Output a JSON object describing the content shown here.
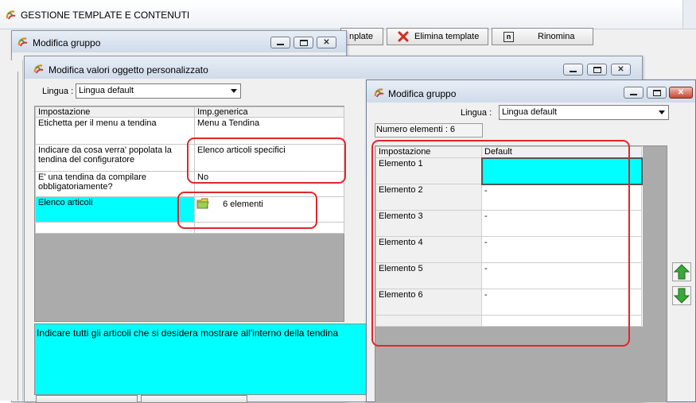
{
  "main_window": {
    "title": "GESTIONE TEMPLATE E CONTENUTI",
    "toolbar": {
      "template_label": "nplate",
      "delete_label": "Elimina template",
      "rename_label": "Rinomina"
    }
  },
  "group_dialog_back": {
    "title": "Modifica gruppo"
  },
  "edit_dialog": {
    "title": "Modifica valori oggetto personalizzato",
    "language_label": "Lingua :",
    "language_value": "Lingua default",
    "columns": [
      "Impostazione",
      "Imp.generica"
    ],
    "rows": [
      {
        "setting": "Etichetta per il menu a tendina",
        "value": "Menu a Tendina"
      },
      {
        "setting": "Indicare da cosa verra' popolata la tendina del configuratore",
        "value": "Elenco articoli specifici"
      },
      {
        "setting": "E' una tendina da compilare obbligatoriamente?",
        "value": "No"
      },
      {
        "setting": "Elenco articoli",
        "value": "6 elementi"
      }
    ],
    "description": "Indicare tutti gli articoli che si desidera mostrare all'interno della tendina"
  },
  "group_dialog_front": {
    "title": "Modifica gruppo",
    "language_label": "Lingua :",
    "language_value": "Lingua default",
    "count_label": "Numero elementi : 6",
    "columns": [
      "Impostazione",
      "Default"
    ],
    "rows": [
      {
        "name": "Elemento 1",
        "value": ""
      },
      {
        "name": "Elemento 2",
        "value": "-"
      },
      {
        "name": "Elemento 3",
        "value": "-"
      },
      {
        "name": "Elemento 4",
        "value": "-"
      },
      {
        "name": "Elemento 5",
        "value": "-"
      },
      {
        "name": "Elemento 6",
        "value": "-"
      }
    ]
  },
  "colors": {
    "highlight": "#00ffff",
    "annotation_red": "#e0262c",
    "grid_background": "#ababab",
    "arrow_green": "#3aa83a"
  },
  "icons": [
    "app-swirl-icon",
    "delete-x-icon",
    "rename-n-icon",
    "folder-icon",
    "arrow-up-icon",
    "arrow-down-icon"
  ]
}
